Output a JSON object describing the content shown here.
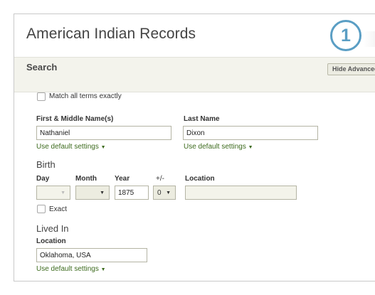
{
  "header": {
    "title": "American Indian Records",
    "step_number": "1"
  },
  "search": {
    "title": "Search",
    "hide_advanced_label": "Hide Advanced"
  },
  "match_exact": {
    "label": "Match all terms exactly",
    "checked": false
  },
  "first_name": {
    "label": "First & Middle Name(s)",
    "value": "Nathaniel",
    "settings_link": "Use default settings"
  },
  "last_name": {
    "label": "Last Name",
    "value": "Dixon",
    "settings_link": "Use default settings"
  },
  "birth": {
    "heading": "Birth",
    "day_label": "Day",
    "month_label": "Month",
    "year_label": "Year",
    "year_value": "1875",
    "plusminus_label": "+/-",
    "plusminus_value": "0",
    "location_label": "Location",
    "location_value": "",
    "exact_label": "Exact",
    "exact_checked": false
  },
  "lived_in": {
    "heading": "Lived In",
    "location_label": "Location",
    "location_value": "Oklahoma, USA",
    "settings_link": "Use default settings"
  },
  "icons": {
    "caret": "▼"
  },
  "colors": {
    "accent": "#5a9ec4",
    "link": "#3d6b1e",
    "bar": "#f3f3ec"
  }
}
